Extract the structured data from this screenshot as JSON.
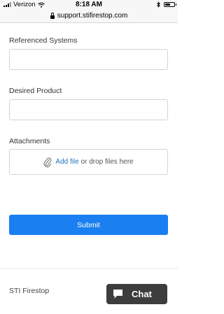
{
  "status_bar": {
    "carrier": "Verizon",
    "time": "8:18 AM",
    "battery_level": 0.6,
    "icons": [
      "signal-icon",
      "wifi-icon",
      "bluetooth-icon",
      "battery-icon"
    ]
  },
  "browser": {
    "url": "support.stifirestop.com"
  },
  "form": {
    "referenced_systems_label": "Referenced Systems",
    "referenced_systems_value": "",
    "desired_product_label": "Desired Product",
    "desired_product_value": "",
    "attachments_label": "Attachments",
    "add_file_link": "Add file",
    "drop_text": "or drop files here",
    "submit_label": "Submit"
  },
  "footer": {
    "brand": "STI Firestop",
    "chat_label": "Chat"
  },
  "colors": {
    "accent": "#1a7ff0",
    "link": "#1f73b7",
    "chat_bg": "#3d3d3d"
  }
}
